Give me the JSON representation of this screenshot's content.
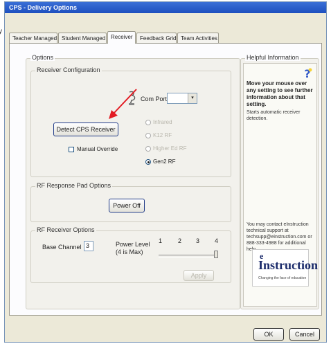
{
  "window": {
    "title": "CPS - Delivery Options"
  },
  "tabs": [
    {
      "label": "Teacher Managed"
    },
    {
      "label": "Student Managed"
    },
    {
      "label": "Receiver"
    },
    {
      "label": "Feedback Grid"
    },
    {
      "label": "Team Activities"
    }
  ],
  "options": {
    "legend": "Options",
    "receiver_config": {
      "legend": "Receiver Configuration",
      "com_port_label": "Com Port",
      "com_port_value": "",
      "detect_button": "Detect CPS Receiver",
      "manual_override": "Manual Override",
      "manual_override_checked": false,
      "receiver_types": [
        {
          "label": "Infrared",
          "enabled": false,
          "selected": false
        },
        {
          "label": "K12 RF",
          "enabled": false,
          "selected": false
        },
        {
          "label": "Higher Ed RF",
          "enabled": false,
          "selected": false
        },
        {
          "label": "Gen2 RF",
          "enabled": true,
          "selected": true
        }
      ]
    },
    "rf_pad": {
      "legend": "RF Response Pad Options",
      "power_off_button": "Power Off"
    },
    "rf_receiver": {
      "legend": "RF Receiver Options",
      "base_channel_label": "Base Channel",
      "base_channel_value": "3",
      "power_level_label": "Power Level",
      "power_level_hint": "(4 is Max)",
      "power_ticks": [
        "1",
        "2",
        "3",
        "4"
      ],
      "power_level_value": 4,
      "apply_button": "Apply"
    }
  },
  "helpful": {
    "legend": "Helpful Information",
    "headline": "Move your mouse over any setting to see further information about that setting.",
    "detail": "Starts automatic receiver detection.",
    "contact": "You may contact eInstruction technical support at techsupp@einstruction.com or 888-333-4988 for additional help.",
    "logo_e": "e",
    "logo_word": "Instruction",
    "logo_tagline": "Changing the face of education"
  },
  "footer": {
    "ok": "OK",
    "cancel": "Cancel"
  },
  "colors": {
    "title_bar": "#1d4fbf",
    "window_bg": "#ece9d8",
    "help_icon": "#f5d33a",
    "annotation_arrow": "#e31b23"
  }
}
